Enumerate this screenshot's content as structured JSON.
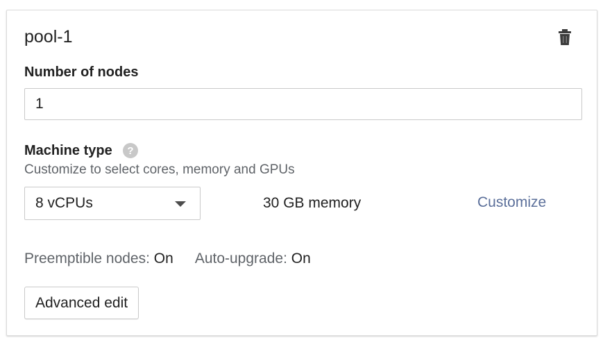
{
  "pool": {
    "title": "pool-1",
    "delete_icon": "trash-icon"
  },
  "nodes": {
    "label": "Number of nodes",
    "value": "1"
  },
  "machine": {
    "label": "Machine type",
    "help_icon": "help-circle-icon",
    "help_text": "Customize to select cores, memory and GPUs",
    "selected": "8 vCPUs",
    "memory": "30 GB memory",
    "customize_label": "Customize"
  },
  "status": {
    "preemptible_label": "Preemptible nodes:",
    "preemptible_value": "On",
    "autoupgrade_label": "Auto-upgrade:",
    "autoupgrade_value": "On"
  },
  "actions": {
    "advanced_edit_label": "Advanced edit"
  },
  "colors": {
    "link": "#5b6f9a",
    "muted_text": "#5f6368",
    "border": "#c9c9c9"
  }
}
